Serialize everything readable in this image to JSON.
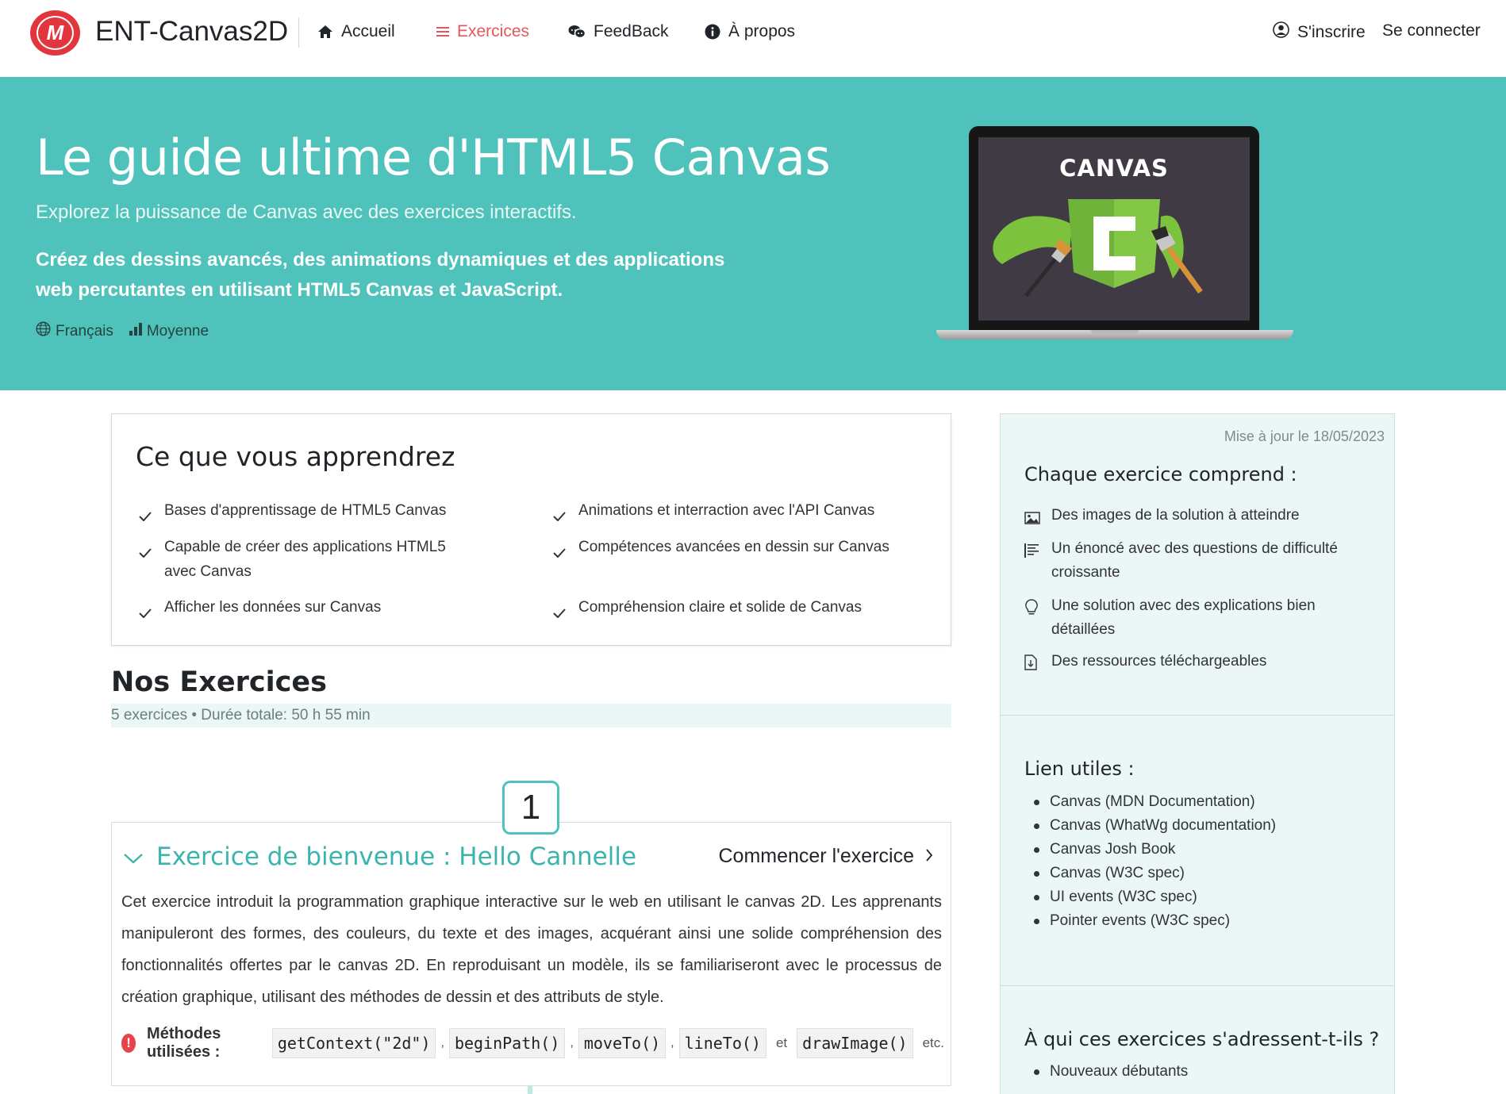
{
  "nav": {
    "brand": "ENT-Canvas2D",
    "logo_letter": "M",
    "items": [
      {
        "label": "Accueil",
        "icon": "home-icon"
      },
      {
        "label": "Exercices",
        "icon": "list-icon",
        "active": true
      },
      {
        "label": "FeedBack",
        "icon": "chat-icon"
      },
      {
        "label": "À propos",
        "icon": "info-icon"
      }
    ],
    "register": "S'inscrire",
    "login": "Se connecter"
  },
  "hero": {
    "title": "Le guide ultime d'HTML5 Canvas",
    "subtitle": "Explorez la puissance de Canvas avec des exercices interactifs.",
    "lead": "Créez des dessins avancés, des animations dynamiques et des applications web percutantes en utilisant HTML5 Canvas et JavaScript.",
    "language": "Français",
    "level": "Moyenne",
    "image_word": "CANVAS"
  },
  "learn": {
    "title": "Ce que vous apprendrez",
    "items": [
      "Bases d'apprentissage de HTML5 Canvas",
      "Animations et interraction avec l'API Canvas",
      "Capable de créer des applications HTML5 avec Canvas",
      "Compétences avancées en dessin sur Canvas",
      "Afficher les données sur Canvas",
      "Compréhension claire et solide de Canvas"
    ]
  },
  "exercises": {
    "heading": "Nos Exercices",
    "summary": "5 exercices • Durée totale: 50 h 55 min",
    "first": {
      "number": "1",
      "title": "Exercice de bienvenue : Hello Cannelle",
      "start_label": "Commencer l'exercice",
      "description": "Cet exercice introduit la programmation graphique interactive sur le web en utilisant le canvas 2D. Les apprenants manipuleront des formes, des couleurs, du texte et des images, acquérant ainsi une solide compréhension des fonctionnalités offertes par le canvas 2D. En reproduisant un modèle, ils se familiariseront avec le processus de création graphique, utilisant des méthodes de dessin et des attributs de style.",
      "methods_label": "Méthodes utilisées :",
      "methods": [
        "getContext(\"2d\")",
        "beginPath()",
        "moveTo()",
        "lineTo()",
        "drawImage()"
      ],
      "and_word": "et",
      "etc": "etc."
    }
  },
  "sidebar": {
    "updated": "Mise à jour le 18/05/2023",
    "includes_title": "Chaque exercice comprend :",
    "includes": [
      {
        "icon": "image-icon",
        "text": "Des images de la solution à atteindre"
      },
      {
        "icon": "text-align-icon",
        "text": "Un énoncé avec des questions de difficulté croissante"
      },
      {
        "icon": "lightbulb-icon",
        "text": "Une solution avec des explications bien détaillées"
      },
      {
        "icon": "download-file-icon",
        "text": "Des ressources téléchargeables"
      }
    ],
    "links_title": "Lien utiles :",
    "links": [
      "Canvas (MDN Documentation)",
      "Canvas (WhatWg documentation)",
      "Canvas Josh Book",
      "Canvas (W3C spec)",
      "UI events (W3C spec)",
      "Pointer events (W3C spec)"
    ],
    "audience_title": "À qui ces exercices s'adressent-t-ils ?",
    "audience": [
      "Nouveaux débutants"
    ]
  },
  "colors": {
    "primary": "#4fc3bb",
    "accent": "#e4575d",
    "logo": "#e2363e",
    "sidebar_bg": "#eaf7f6"
  }
}
